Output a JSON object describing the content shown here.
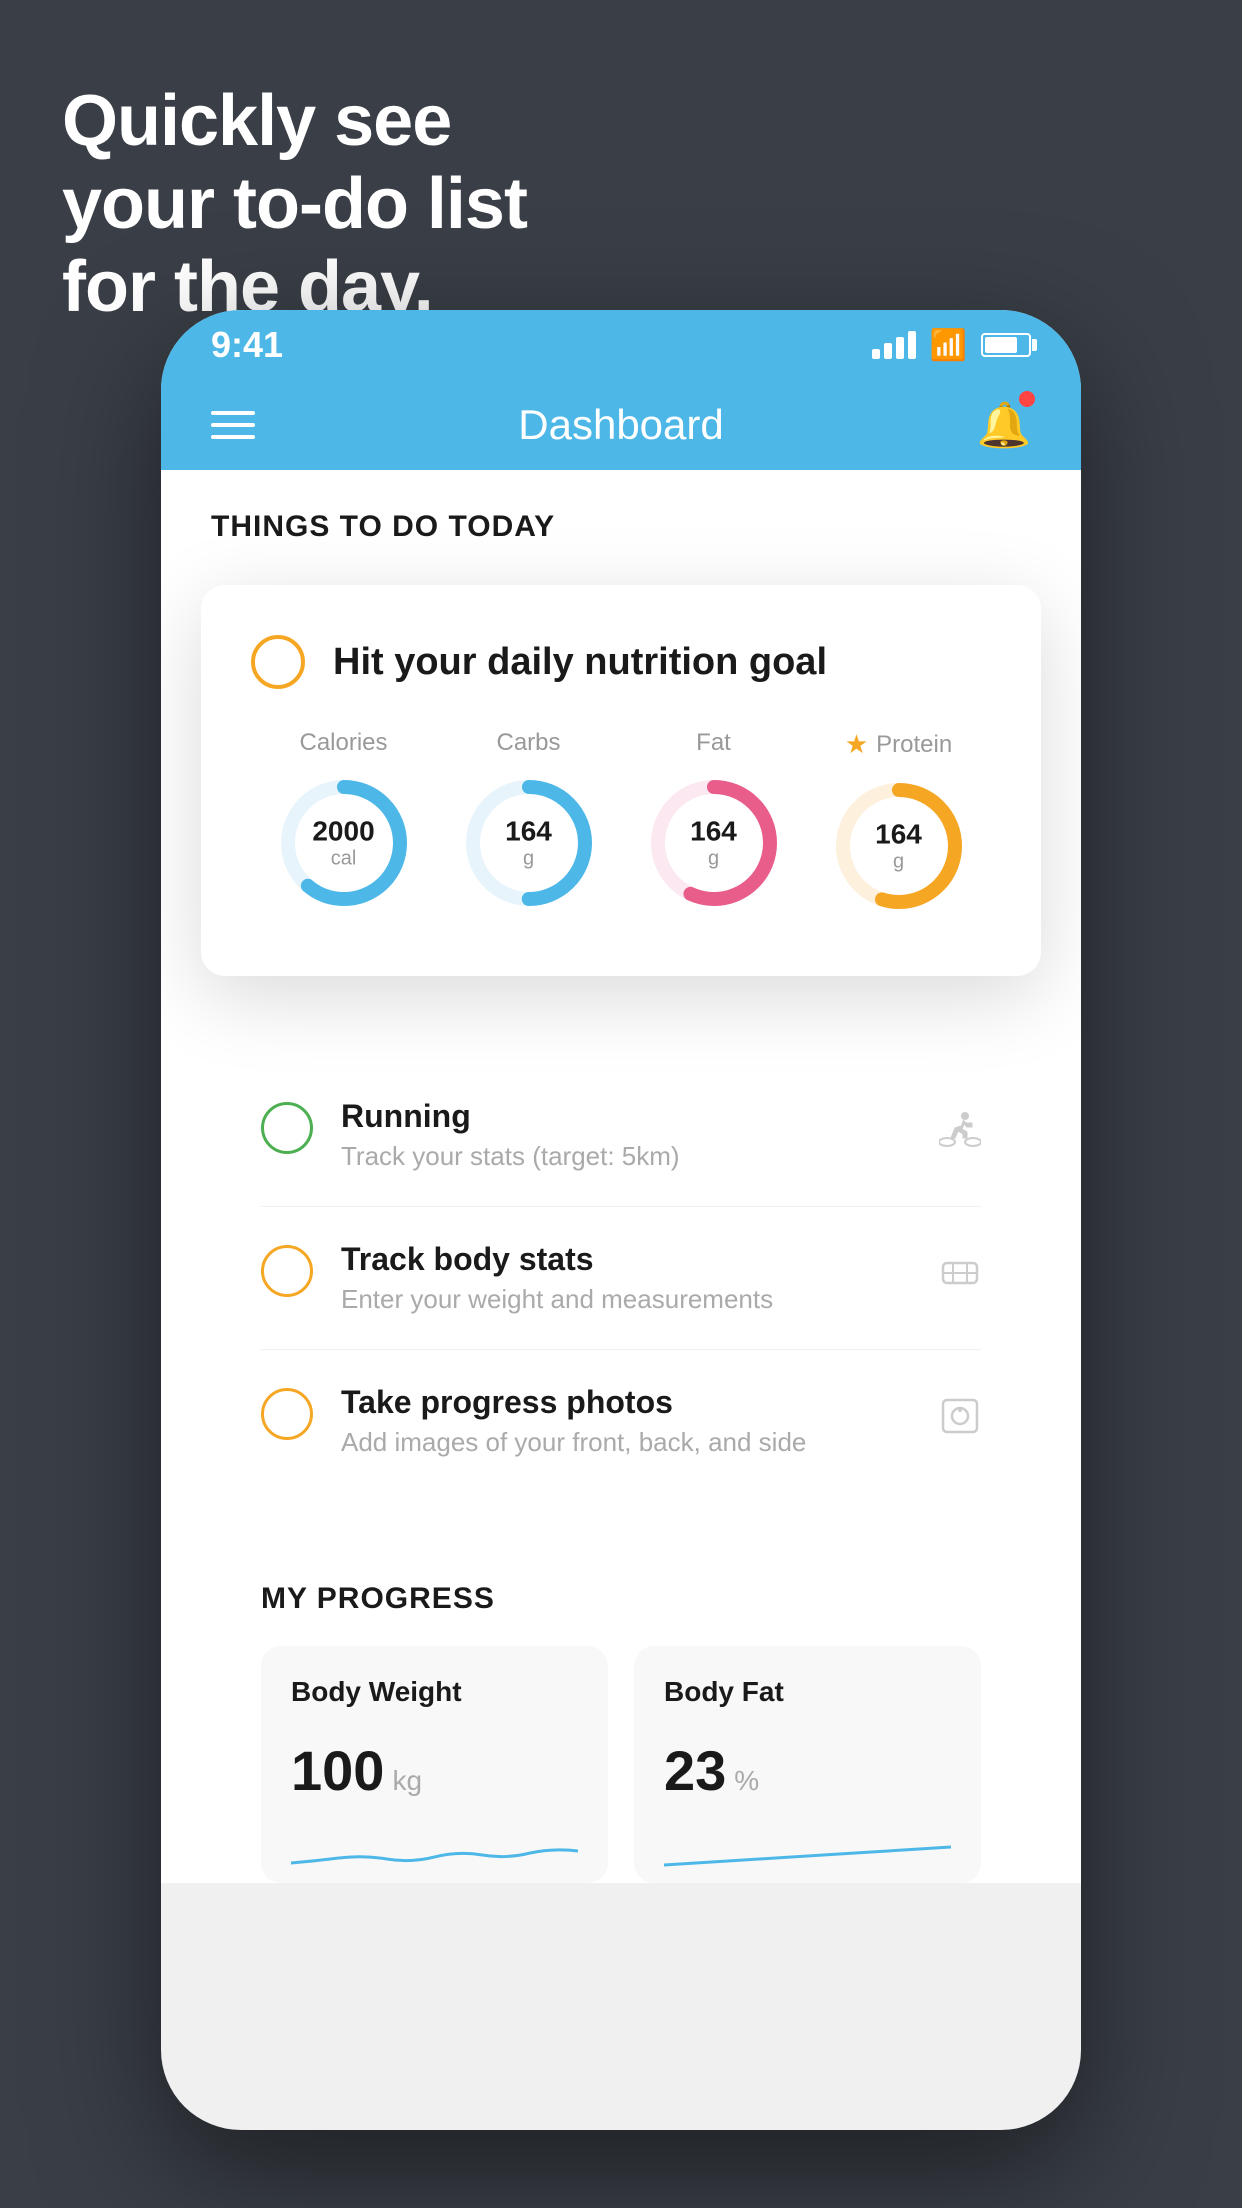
{
  "page": {
    "background_color": "#3a3f47",
    "hero_text": "Quickly see\nyour to-do list\nfor the day."
  },
  "phone": {
    "status_bar": {
      "time": "9:41",
      "signal": 4,
      "battery_pct": 75
    },
    "header": {
      "title": "Dashboard"
    },
    "things_section": {
      "label": "THINGS TO DO TODAY"
    },
    "nutrition_card": {
      "check_label": "Hit your daily nutrition goal",
      "items": [
        {
          "label": "Calories",
          "value": "2000",
          "unit": "cal",
          "color": "#4db8e8",
          "pct": 65,
          "starred": false
        },
        {
          "label": "Carbs",
          "value": "164",
          "unit": "g",
          "color": "#4db8e8",
          "pct": 50,
          "starred": false
        },
        {
          "label": "Fat",
          "value": "164",
          "unit": "g",
          "color": "#e85d8a",
          "pct": 60,
          "starred": false
        },
        {
          "label": "Protein",
          "value": "164",
          "unit": "g",
          "color": "#f5a623",
          "pct": 55,
          "starred": true
        }
      ]
    },
    "todo_items": [
      {
        "id": "running",
        "title": "Running",
        "subtitle": "Track your stats (target: 5km)",
        "circle_color": "green",
        "icon": "👟"
      },
      {
        "id": "body-stats",
        "title": "Track body stats",
        "subtitle": "Enter your weight and measurements",
        "circle_color": "yellow",
        "icon": "⚖"
      },
      {
        "id": "photos",
        "title": "Take progress photos",
        "subtitle": "Add images of your front, back, and side",
        "circle_color": "yellow",
        "icon": "👤"
      }
    ],
    "progress_section": {
      "label": "MY PROGRESS",
      "cards": [
        {
          "id": "body-weight",
          "title": "Body Weight",
          "value": "100",
          "unit": "kg"
        },
        {
          "id": "body-fat",
          "title": "Body Fat",
          "value": "23",
          "unit": "%"
        }
      ]
    }
  }
}
